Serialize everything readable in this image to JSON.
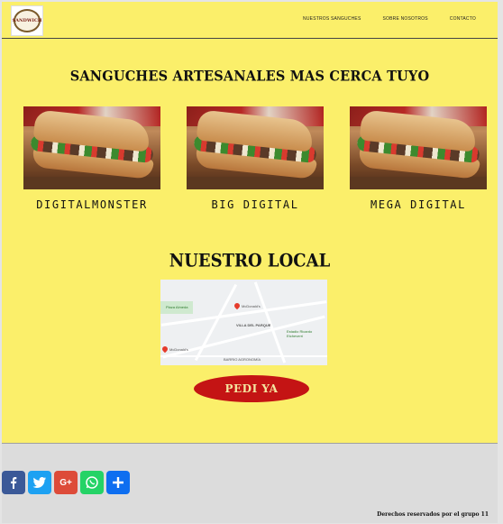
{
  "logo": {
    "text": "SANDWICH"
  },
  "nav": {
    "items": [
      "NUESTROS SANGUCHES",
      "SOBRE NOSOTROS",
      "CONTACTO"
    ]
  },
  "hero": {
    "title": "SANGUCHES ARTESANALES MAS CERCA TUYO"
  },
  "products": [
    {
      "name": "DIGITALMONSTER"
    },
    {
      "name": "BIG DIGITAL"
    },
    {
      "name": "MEGA DIGITAL"
    }
  ],
  "local": {
    "title": "NUESTRO LOCAL"
  },
  "map": {
    "labels": [
      "Plaza Almeda",
      "McDonald's",
      "VILLA DEL PARQUE",
      "McDonald's",
      "BARRIO AGRONOMÍA",
      "Estadio Ricardo Etcheverri"
    ]
  },
  "cta": {
    "label": "PEDI YA"
  },
  "social": [
    {
      "icon": "facebook-icon",
      "color": "#3b5998",
      "glyph": "f"
    },
    {
      "icon": "twitter-icon",
      "color": "#1da1f2",
      "glyph": "t"
    },
    {
      "icon": "google-plus-icon",
      "color": "#dd4b39",
      "glyph": "G+"
    },
    {
      "icon": "whatsapp-icon",
      "color": "#25d366",
      "glyph": "w"
    },
    {
      "icon": "share-plus-icon",
      "color": "#0e6ef0",
      "glyph": "+"
    }
  ],
  "footer": {
    "copyright": "Derechos reservados por el grupo 11"
  }
}
